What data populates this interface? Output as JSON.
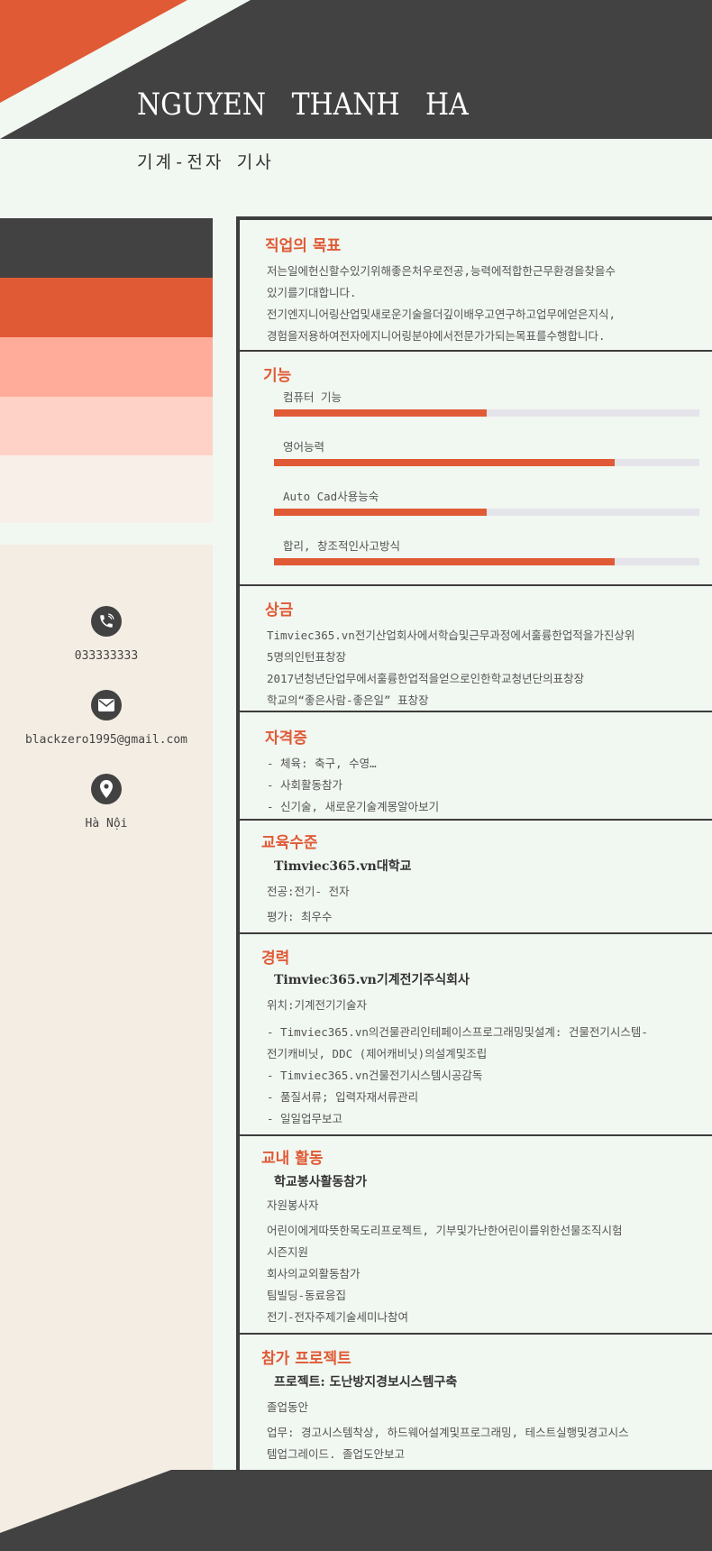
{
  "header": {
    "name": "NGUYEN   THANH   HA",
    "job_title": "기계-전자 기사"
  },
  "contact": {
    "phone": "033333333",
    "email": "blackzero1995@gmail.com",
    "address": "Hà Nội"
  },
  "colors": {
    "accent": "#e05a36",
    "dark": "#424242",
    "stripes": [
      "#424242",
      "#e05a36",
      "#ffad9a",
      "#ffd2c7",
      "#f9efe9"
    ]
  },
  "icons": [
    "phone-icon",
    "mail-icon",
    "location-icon"
  ],
  "objective": {
    "title": "직업의 목표",
    "lines": [
      "저는일에헌신할수있기위해좋은처우로전공,능력에적합한근무환경을찾을수",
      "있기를기대합니다.",
      "전기엔지니어링산업및새로운기술을더깊이배우고연구하고업무에얻은지식,",
      "경험을저용하여전자에지니어링분야에서전문가가되는목표를수행합니다."
    ]
  },
  "skills": {
    "title": "기능",
    "items": [
      {
        "label": "컴퓨터 기능",
        "level": 0.5
      },
      {
        "label": "영어능력",
        "level": 0.8
      },
      {
        "label": "Auto Cad사용능숙",
        "level": 0.5
      },
      {
        "label": "합리, 창조적인사고방식",
        "level": 0.8
      }
    ]
  },
  "awards": {
    "title": "상금",
    "lines": [
      "Timviec365.vn전기산업회사에서학습및근무과정에서훌륭한업적을가진상위",
      "5명의인턴표창장",
      "2017년청년단업무에서훌륭한업적을얻으로인한학교청년단의표창장",
      "학교의“좋은사람-좋은일” 표창장"
    ]
  },
  "certificates": {
    "title": "자격증",
    "lines": [
      "- 체육: 축구, 수영…",
      "- 사회활동참가",
      "- 신기술, 새로운기술계몽알아보기"
    ]
  },
  "education": {
    "title": "교육수준",
    "org": "Timviec365.vn대학교",
    "lines": [
      "전공:전기- 전자",
      "평가: 최우수"
    ]
  },
  "experience": {
    "title": "경력",
    "org": "Timviec365.vn기계전기주식회사",
    "position": "위치:기계전기기술자",
    "lines": [
      "- Timviec365.vn의건물관리인테페이스프로그래밍및설계: 건물전기시스템-",
      "전기캐비닛, DDC (제어캐비닛)의설계및조립",
      "- Timviec365.vn건물전기시스템시공감독",
      "- 품질서류; 입력자재서류관리",
      "- 일일업무보고"
    ]
  },
  "activities": {
    "title": "교내 활동",
    "org": "학교봉사활동참가",
    "role": "자원봉사자",
    "lines": [
      "어린이에게따뜻한목도리프로젝트, 기부및가난한어린이를위한선물조직시험",
      "시즌지원",
      "회사의교외활동참가",
      "팀빌딩-동료응집",
      "전기-전자주제기술세미나참여"
    ]
  },
  "projects": {
    "title": "참가 프로젝트",
    "org": "프로젝트: 도난방지경보시스템구축",
    "period": "졸업동안",
    "lines": [
      "업무: 경고시스템착상, 하드웨어설계및프로그래밍, 테스트실행및경고시스",
      "템업그레이드. 졸업도안보고"
    ]
  }
}
